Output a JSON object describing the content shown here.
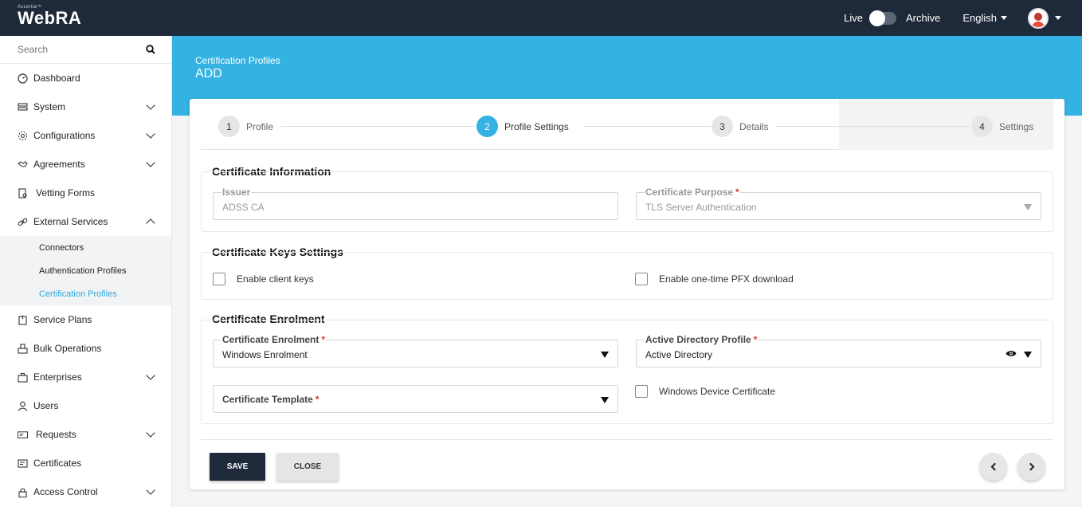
{
  "app": {
    "brand_small": "Ascertia™",
    "brand": "WebRA"
  },
  "topbar": {
    "live": "Live",
    "archive": "Archive",
    "language": "English"
  },
  "sidebar": {
    "search_placeholder": "Search",
    "items": [
      {
        "label": "Dashboard",
        "icon": "dashboard-icon"
      },
      {
        "label": "System",
        "icon": "system-icon"
      },
      {
        "label": "Configurations",
        "icon": "gear-icon"
      },
      {
        "label": "Agreements",
        "icon": "handshake-icon"
      },
      {
        "label": "Vetting Forms",
        "icon": "form-icon"
      },
      {
        "label": "External Services",
        "icon": "link-icon"
      },
      {
        "label": "Service Plans",
        "icon": "plan-icon"
      },
      {
        "label": "Bulk Operations",
        "icon": "bulk-icon"
      },
      {
        "label": "Enterprises",
        "icon": "enterprise-icon"
      },
      {
        "label": "Users",
        "icon": "user-icon"
      },
      {
        "label": "Requests",
        "icon": "requests-icon"
      },
      {
        "label": "Certificates",
        "icon": "certificate-icon"
      },
      {
        "label": "Access Control",
        "icon": "lock-icon"
      }
    ],
    "sub_items": [
      "Connectors",
      "Authentication Profiles",
      "Certification Profiles"
    ]
  },
  "banner": {
    "crumb": "Certification Profiles",
    "title": "ADD"
  },
  "steps": [
    {
      "num": "1",
      "label": "Profile"
    },
    {
      "num": "2",
      "label": "Profile Settings"
    },
    {
      "num": "3",
      "label": "Details"
    },
    {
      "num": "4",
      "label": "Settings"
    }
  ],
  "cert_info": {
    "title": "Certificate Information",
    "issuer_label": "Issuer",
    "issuer_value": "ADSS CA",
    "purpose_label": "Certificate Purpose",
    "purpose_value": "TLS Server Authentication"
  },
  "keys": {
    "title": "Certificate Keys Settings",
    "client_keys": "Enable client keys",
    "pfx": "Enable one-time PFX download"
  },
  "enrolment": {
    "title": "Certificate Enrolment",
    "enrolment_label": "Certificate Enrolment",
    "enrolment_value": "Windows Enrolment",
    "ad_label": "Active Directory Profile",
    "ad_value": "Active Directory",
    "template_label": "Certificate Template",
    "device_cert": "Windows Device Certificate"
  },
  "actions": {
    "save": "SAVE",
    "close": "CLOSE"
  },
  "colors": {
    "accent": "#33b2e3",
    "dark": "#1e2a3a",
    "required": "#d9363e"
  }
}
